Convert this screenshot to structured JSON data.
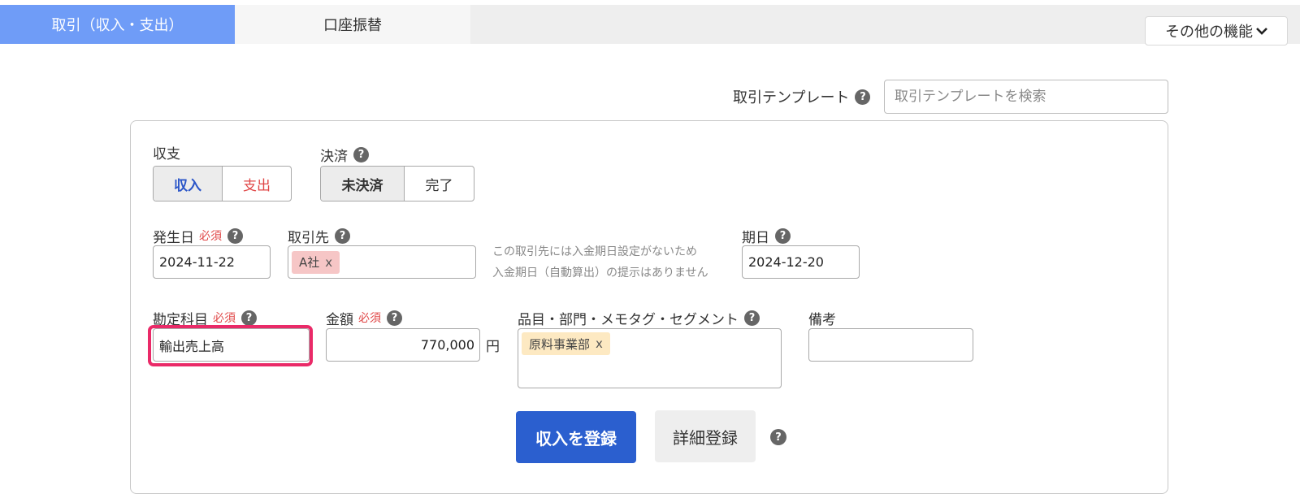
{
  "tabs": [
    {
      "label": "取引（収入・支出）",
      "active": true
    },
    {
      "label": "口座振替",
      "active": false
    }
  ],
  "more_features": {
    "label": "その他の機能"
  },
  "template": {
    "label": "取引テンプレート",
    "placeholder": "取引テンプレートを検索"
  },
  "form": {
    "type": {
      "label": "収支",
      "options": [
        "収入",
        "支出"
      ],
      "selected": "収入"
    },
    "settlement": {
      "label": "決済",
      "options": [
        "未決済",
        "完了"
      ],
      "selected": "未決済"
    },
    "date": {
      "label": "発生日",
      "required": "必須",
      "value": "2024-11-22"
    },
    "partner": {
      "label": "取引先",
      "tag": "A社",
      "tag_remove": "x"
    },
    "note_lines": [
      "この取引先には入金期日設定がないため",
      "入金期日（自動算出）の提示はありません"
    ],
    "due": {
      "label": "期日",
      "value": "2024-12-20"
    },
    "account": {
      "label": "勘定科目",
      "required": "必須",
      "value": "輸出売上高"
    },
    "amount": {
      "label": "金額",
      "required": "必須",
      "value": "770,000",
      "unit": "円"
    },
    "items": {
      "label": "品目・部門・メモタグ・セグメント",
      "tag": "原料事業部",
      "tag_remove": "x"
    },
    "remarks": {
      "label": "備考",
      "value": ""
    }
  },
  "buttons": {
    "register": "収入を登録",
    "detail": "詳細登録"
  },
  "help_glyph": "?",
  "colors": {
    "accent_tab": "#6f9cf7",
    "primary": "#2b5fcf",
    "income": "#2a55c8",
    "expense": "#e04848",
    "required": "#e04848",
    "highlight": "#ea2a68"
  }
}
